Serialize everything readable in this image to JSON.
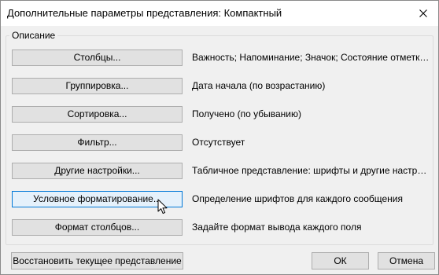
{
  "dialog": {
    "title": "Дополнительные параметры представления: Компактный",
    "close_icon": "close-icon"
  },
  "description_group": {
    "legend": "Описание",
    "rows": [
      {
        "button": "Столбцы...",
        "description": "Важность; Напоминание; Значок; Состояние отметки..."
      },
      {
        "button": "Группировка...",
        "description": "Дата начала (по возрастанию)"
      },
      {
        "button": "Сортировка...",
        "description": "Получено (по убыванию)"
      },
      {
        "button": "Фильтр...",
        "description": "Отсутствует"
      },
      {
        "button": "Другие настройки...",
        "description": "Табличное представление: шрифты и другие настрой..."
      },
      {
        "button": "Условное форматирование...",
        "description": "Определение шрифтов для каждого сообщения"
      },
      {
        "button": "Формат столбцов...",
        "description": "Задайте формат вывода каждого поля"
      }
    ]
  },
  "footer": {
    "reset_label": "Восстановить текущее представление",
    "ok_label": "ОК",
    "cancel_label": "Отмена"
  },
  "colors": {
    "hover_border": "#0078d7",
    "hover_fill": "#e5f1fb",
    "panel_bg": "#f0f0f0"
  }
}
